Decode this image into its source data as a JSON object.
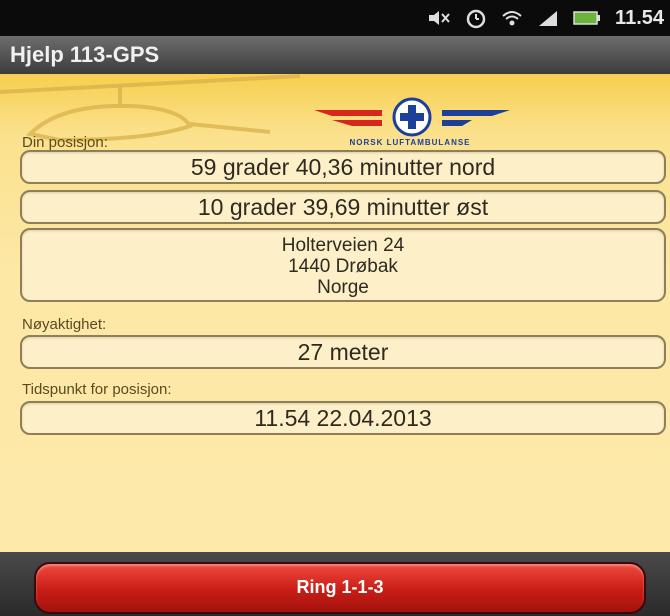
{
  "status_bar": {
    "time": "11.54",
    "icons": [
      "mute-icon",
      "alarm-icon",
      "wifi-icon",
      "signal-icon",
      "battery-icon"
    ]
  },
  "app": {
    "title": "Hjelp 113-GPS"
  },
  "logo": {
    "caption": "NORSK LUFTAMBULANSE"
  },
  "position": {
    "label": "Din posisjon:",
    "latitude": "59 grader 40,36 minutter nord",
    "longitude": "10 grader 39,69 minutter øst",
    "address_line1": "Holterveien 24",
    "address_line2": "1440 Drøbak",
    "address_line3": "Norge"
  },
  "accuracy": {
    "label": "Nøyaktighet:",
    "value": "27 meter"
  },
  "timestamp": {
    "label": "Tidspunkt for posisjon:",
    "value": "11.54 22.04.2013"
  },
  "call_button": {
    "label": "Ring 1-1-3"
  },
  "colors": {
    "accent_red": "#c81d16",
    "background_yellow": "#fbe38a",
    "logo_blue": "#1c3f9a",
    "logo_red": "#d7261e"
  }
}
